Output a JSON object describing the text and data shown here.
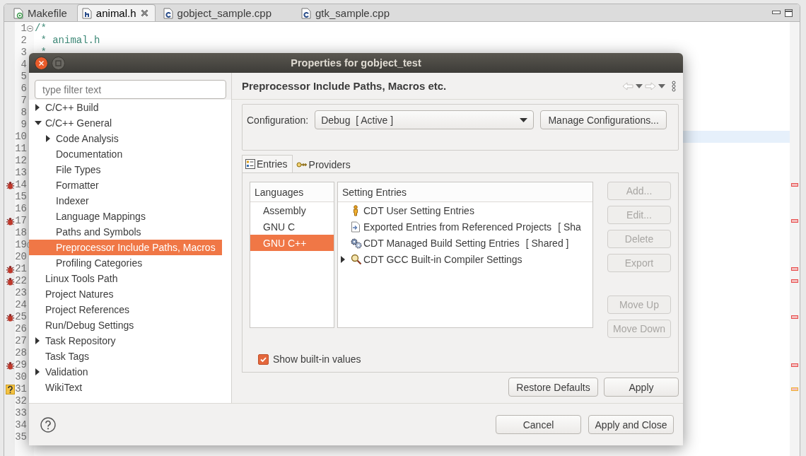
{
  "editor_tabs": [
    {
      "label": "Makefile",
      "kind": "makefile",
      "selected": false
    },
    {
      "label": "animal.h",
      "kind": "header",
      "selected": true
    },
    {
      "label": "gobject_sample.cpp",
      "kind": "source",
      "selected": false
    },
    {
      "label": "gtk_sample.cpp",
      "kind": "source",
      "selected": false
    }
  ],
  "editor": {
    "lines": [
      {
        "number": "1",
        "code": "/*",
        "fold": true,
        "bug": false,
        "question": false,
        "current": false
      },
      {
        "number": "2",
        "code": " * animal.h",
        "fold": false,
        "bug": false,
        "question": false,
        "current": false
      },
      {
        "number": "3",
        "code": " *",
        "fold": false,
        "bug": false,
        "question": false,
        "current": false
      },
      {
        "number": "4",
        "fold": false,
        "bug": false,
        "question": false,
        "current": false
      },
      {
        "number": "5",
        "fold": false,
        "bug": false,
        "question": false,
        "current": false
      },
      {
        "number": "6",
        "fold": false,
        "bug": false,
        "question": false,
        "current": false
      },
      {
        "number": "7",
        "fold": false,
        "bug": false,
        "question": false,
        "current": false
      },
      {
        "number": "8",
        "fold": false,
        "bug": false,
        "question": false,
        "current": false
      },
      {
        "number": "9",
        "fold": false,
        "bug": false,
        "question": false,
        "current": false
      },
      {
        "number": "10",
        "fold": false,
        "bug": false,
        "question": false,
        "current": true
      },
      {
        "number": "11",
        "fold": false,
        "bug": false,
        "question": false,
        "current": false
      },
      {
        "number": "12",
        "fold": false,
        "bug": false,
        "question": false,
        "current": false
      },
      {
        "number": "13",
        "fold": false,
        "bug": false,
        "question": false,
        "current": false
      },
      {
        "number": "14",
        "fold": false,
        "bug": true,
        "question": false,
        "current": false
      },
      {
        "number": "15",
        "fold": false,
        "bug": false,
        "question": false,
        "current": false
      },
      {
        "number": "16",
        "fold": false,
        "bug": false,
        "question": false,
        "current": false
      },
      {
        "number": "17",
        "fold": false,
        "bug": true,
        "question": false,
        "current": false
      },
      {
        "number": "18",
        "fold": false,
        "bug": false,
        "question": false,
        "current": false
      },
      {
        "number": "19",
        "fold": true,
        "bug": false,
        "question": false,
        "current": false
      },
      {
        "number": "20",
        "fold": false,
        "bug": false,
        "question": false,
        "current": false
      },
      {
        "number": "21",
        "fold": false,
        "bug": true,
        "question": false,
        "current": false
      },
      {
        "number": "22",
        "fold": false,
        "bug": true,
        "question": false,
        "current": false
      },
      {
        "number": "23",
        "fold": false,
        "bug": false,
        "question": false,
        "current": false
      },
      {
        "number": "24",
        "fold": false,
        "bug": false,
        "question": false,
        "current": false
      },
      {
        "number": "25",
        "fold": false,
        "bug": true,
        "question": false,
        "current": false
      },
      {
        "number": "26",
        "fold": false,
        "bug": false,
        "question": false,
        "current": false
      },
      {
        "number": "27",
        "fold": false,
        "bug": false,
        "question": false,
        "current": false
      },
      {
        "number": "28",
        "fold": false,
        "bug": false,
        "question": false,
        "current": false
      },
      {
        "number": "29",
        "fold": false,
        "bug": true,
        "question": false,
        "current": false
      },
      {
        "number": "30",
        "fold": false,
        "bug": false,
        "question": false,
        "current": false
      },
      {
        "number": "31",
        "fold": false,
        "bug": false,
        "question": true,
        "current": false
      },
      {
        "number": "32",
        "fold": false,
        "bug": false,
        "question": false,
        "current": false
      },
      {
        "number": "33",
        "fold": false,
        "bug": false,
        "question": false,
        "current": false
      },
      {
        "number": "34",
        "fold": false,
        "bug": false,
        "question": false,
        "current": false
      },
      {
        "number": "35",
        "fold": false,
        "bug": false,
        "question": false,
        "current": false
      }
    ]
  },
  "dialog": {
    "title": "Properties for gobject_test",
    "filter": {
      "placeholder": "type filter text"
    },
    "tree": [
      {
        "label": "C/C++ Build",
        "expandable": true,
        "expanded": false,
        "selected": false
      },
      {
        "label": "C/C++ General",
        "expandable": true,
        "expanded": true,
        "selected": false,
        "children": [
          {
            "label": "Code Analysis",
            "expandable": true,
            "expanded": false,
            "selected": false
          },
          {
            "label": "Documentation",
            "expandable": false,
            "selected": false
          },
          {
            "label": "File Types",
            "expandable": false,
            "selected": false
          },
          {
            "label": "Formatter",
            "expandable": false,
            "selected": false
          },
          {
            "label": "Indexer",
            "expandable": false,
            "selected": false
          },
          {
            "label": "Language Mappings",
            "expandable": false,
            "selected": false
          },
          {
            "label": "Paths and Symbols",
            "expandable": false,
            "selected": false
          },
          {
            "label": "Preprocessor Include Paths, Macros",
            "expandable": false,
            "selected": true
          },
          {
            "label": "Profiling Categories",
            "expandable": false,
            "selected": false
          }
        ]
      },
      {
        "label": "Linux Tools Path",
        "expandable": false,
        "selected": false
      },
      {
        "label": "Project Natures",
        "expandable": false,
        "selected": false
      },
      {
        "label": "Project References",
        "expandable": false,
        "selected": false
      },
      {
        "label": "Run/Debug Settings",
        "expandable": false,
        "selected": false
      },
      {
        "label": "Task Repository",
        "expandable": true,
        "expanded": false,
        "selected": false
      },
      {
        "label": "Task Tags",
        "expandable": false,
        "selected": false
      },
      {
        "label": "Validation",
        "expandable": true,
        "expanded": false,
        "selected": false
      },
      {
        "label": "WikiText",
        "expandable": false,
        "selected": false
      }
    ],
    "page": {
      "title": "Preprocessor Include Paths, Macros etc.",
      "configuration": {
        "label": "Configuration:",
        "value": "Debug  [ Active ]"
      },
      "manage_button": "Manage Configurations...",
      "tabs": [
        {
          "label": "Entries",
          "kind": "entries",
          "selected": true
        },
        {
          "label": "Providers",
          "kind": "providers",
          "selected": false
        }
      ],
      "languages": {
        "heading": "Languages",
        "items": [
          {
            "label": "Assembly",
            "selected": false
          },
          {
            "label": "GNU C",
            "selected": false
          },
          {
            "label": "GNU C++",
            "selected": true
          }
        ]
      },
      "entries": {
        "heading": "Setting Entries",
        "items": [
          {
            "label": "CDT User Setting Entries",
            "kind": "user",
            "expandable": false
          },
          {
            "label": "Exported Entries from Referenced Projects",
            "suffix": "[ Sha",
            "kind": "exported",
            "expandable": false
          },
          {
            "label": "CDT Managed Build Setting Entries",
            "suffix": "[ Shared ]",
            "kind": "managed",
            "expandable": false
          },
          {
            "label": "CDT GCC Built-in Compiler Settings",
            "kind": "compiler",
            "expandable": true
          }
        ]
      },
      "side_buttons": [
        {
          "label": "Add...",
          "disabled": true,
          "gap_before": false
        },
        {
          "label": "Edit...",
          "disabled": true,
          "gap_before": false
        },
        {
          "label": "Delete",
          "disabled": true,
          "gap_before": false
        },
        {
          "label": "Export",
          "disabled": true,
          "gap_before": false
        },
        {
          "label": "Move Up",
          "disabled": true,
          "gap_before": true
        },
        {
          "label": "Move Down",
          "disabled": true,
          "gap_before": false
        }
      ],
      "show_builtin": {
        "label": "Show built-in values",
        "checked": true
      },
      "restore_button": "Restore Defaults",
      "apply_button": "Apply"
    },
    "footer": {
      "cancel_button": "Cancel",
      "apply_close_button": "Apply and Close"
    }
  }
}
